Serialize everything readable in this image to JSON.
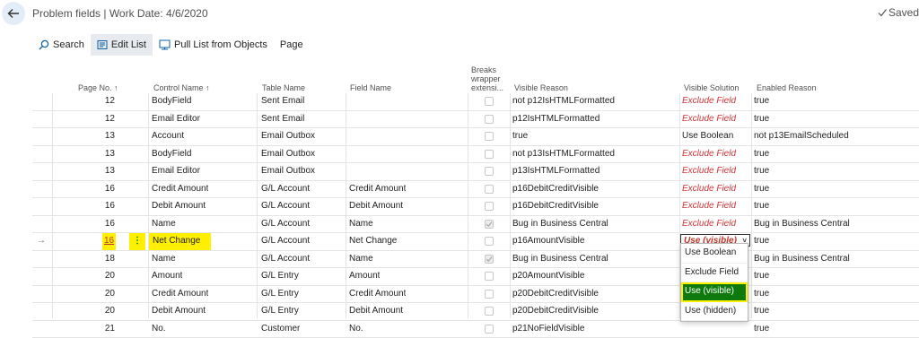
{
  "header": {
    "title": "Problem fields | Work Date: 4/6/2020",
    "saved": "Saved"
  },
  "toolbar": {
    "search": "Search",
    "edit_list": "Edit List",
    "pull_list": "Pull List from Objects",
    "page": "Page"
  },
  "columns": {
    "page_no": "Page No. ↑",
    "control_name": "Control Name ↑",
    "table_name": "Table Name",
    "field_name": "Field Name",
    "breaks_wrapper": "Breaks wrapper extensi...",
    "visible_reason": "Visible Reason",
    "visible_solution": "Visible Solution",
    "enabled_reason": "Enabled Reason"
  },
  "rows": [
    {
      "page": "12",
      "control": "BodyField",
      "table": "Sent Email",
      "field": "",
      "breaks": false,
      "reason": "not p12IsHTMLFormatted",
      "solution": "Exclude Field",
      "enabled": "true"
    },
    {
      "page": "12",
      "control": "Email Editor",
      "table": "Sent Email",
      "field": "",
      "breaks": false,
      "reason": "p12IsHTMLFormatted",
      "solution": "Exclude Field",
      "enabled": "true"
    },
    {
      "page": "13",
      "control": "Account",
      "table": "Email Outbox",
      "field": "",
      "breaks": false,
      "reason": "true",
      "solution": "Use Boolean",
      "enabled": "not p13EmailScheduled"
    },
    {
      "page": "13",
      "control": "BodyField",
      "table": "Email Outbox",
      "field": "",
      "breaks": false,
      "reason": "not p13IsHTMLFormatted",
      "solution": "Exclude Field",
      "enabled": "true"
    },
    {
      "page": "13",
      "control": "Email Editor",
      "table": "Email Outbox",
      "field": "",
      "breaks": false,
      "reason": "p13IsHTMLFormatted",
      "solution": "Exclude Field",
      "enabled": "true"
    },
    {
      "page": "16",
      "control": "Credit Amount",
      "table": "G/L Account",
      "field": "Credit Amount",
      "breaks": false,
      "reason": "p16DebitCreditVisible",
      "solution": "Exclude Field",
      "enabled": "true"
    },
    {
      "page": "16",
      "control": "Debit Amount",
      "table": "G/L Account",
      "field": "Debit Amount",
      "breaks": false,
      "reason": "p16DebitCreditVisible",
      "solution": "Exclude Field",
      "enabled": "true"
    },
    {
      "page": "16",
      "control": "Name",
      "table": "G/L Account",
      "field": "Name",
      "breaks": true,
      "reason": "Bug in Business Central",
      "solution": "Exclude Field",
      "enabled": "Bug in Business Central"
    },
    {
      "page": "16",
      "control": "Net Change",
      "table": "G/L Account",
      "field": "Net Change",
      "breaks": false,
      "reason": "p16AmountVisible",
      "solution": "Use (visible)",
      "enabled": "true",
      "selected": true
    },
    {
      "page": "18",
      "control": "Name",
      "table": "G/L Account",
      "field": "Name",
      "breaks": true,
      "reason": "Bug in Business Central",
      "solution": "",
      "enabled": "Bug in Business Central"
    },
    {
      "page": "20",
      "control": "Amount",
      "table": "G/L Entry",
      "field": "Amount",
      "breaks": false,
      "reason": "p20AmountVisible",
      "solution": "",
      "enabled": "true"
    },
    {
      "page": "20",
      "control": "Credit Amount",
      "table": "G/L Entry",
      "field": "Credit Amount",
      "breaks": false,
      "reason": "p20DebitCreditVisible",
      "solution": "",
      "enabled": "true"
    },
    {
      "page": "20",
      "control": "Debit Amount",
      "table": "G/L Entry",
      "field": "Debit Amount",
      "breaks": false,
      "reason": "p20DebitCreditVisible",
      "solution": "",
      "enabled": "true"
    },
    {
      "page": "21",
      "control": "No.",
      "table": "Customer",
      "field": "No.",
      "breaks": false,
      "reason": "p21NoFieldVisible",
      "solution": "",
      "enabled": "true"
    }
  ],
  "dropdown": {
    "options": [
      "Use Boolean",
      "Exclude Field",
      "Use (visible)",
      "Use (hidden)"
    ],
    "selected": "Use (visible)"
  },
  "icons": {
    "back": "arrow-left-icon",
    "search": "search-icon",
    "edit": "edit-list-icon",
    "pull": "pull-list-icon",
    "check": "check-icon",
    "row_arrow": "arrow-right-icon",
    "more": "more-vertical-icon"
  },
  "colors": {
    "accent": "#0e7a0d",
    "highlight": "#ffef00",
    "exclude": "#d13438"
  }
}
